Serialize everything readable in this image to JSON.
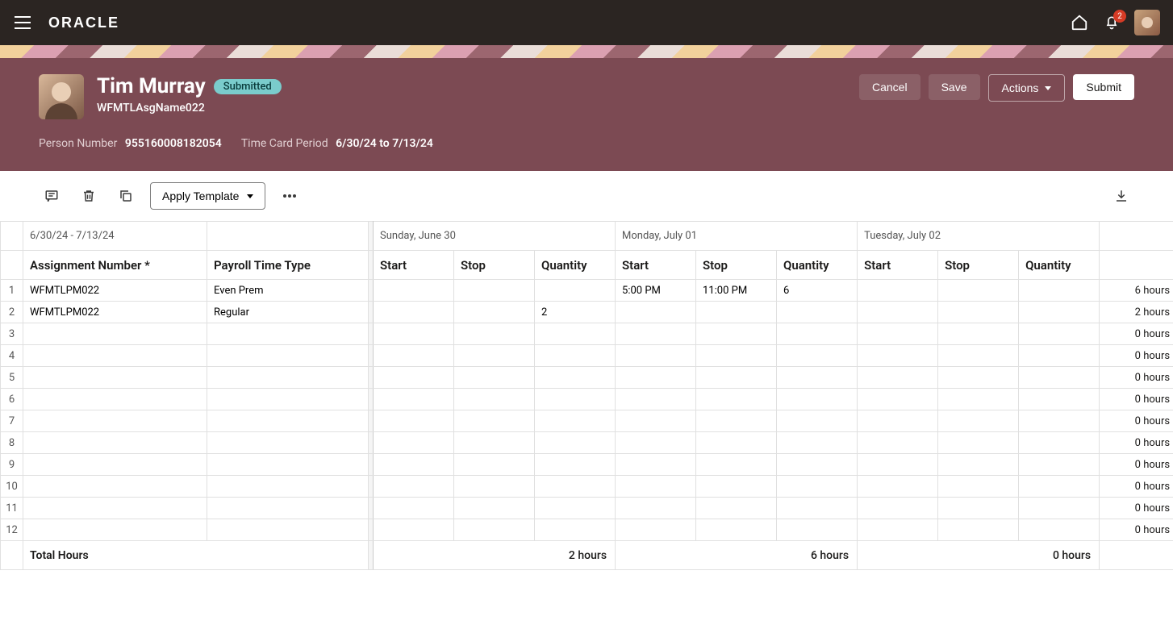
{
  "topbar": {
    "logo": "ORACLE",
    "notification_count": "2"
  },
  "header": {
    "person_name": "Tim Murray",
    "status": "Submitted",
    "assignment_name": "WFMTLAsgName022",
    "person_number_label": "Person Number",
    "person_number": "955160008182054",
    "period_label": "Time Card Period",
    "period": "6/30/24 to 7/13/24",
    "actions": {
      "cancel": "Cancel",
      "save": "Save",
      "actions": "Actions",
      "submit": "Submit"
    }
  },
  "toolbar": {
    "apply_template": "Apply Template"
  },
  "grid": {
    "date_range": "6/30/24 - 7/13/24",
    "days": [
      {
        "label": "Sunday, June 30",
        "total": "2 hours"
      },
      {
        "label": "Monday, July 01",
        "total": "6 hours"
      },
      {
        "label": "Tuesday, July 02",
        "total": "0 hours"
      }
    ],
    "col_headers": {
      "assignment": "Assignment Number *",
      "payroll_type": "Payroll Time Type",
      "start": "Start",
      "stop": "Stop",
      "quantity": "Quantity"
    },
    "rows": [
      {
        "n": "1",
        "asg": "WFMTLPM022",
        "ptt": "Even Prem",
        "d": [
          {
            "start": "",
            "stop": "",
            "qty": ""
          },
          {
            "start": "5:00 PM",
            "stop": "11:00 PM",
            "qty": "6"
          },
          {
            "start": "",
            "stop": "",
            "qty": ""
          }
        ],
        "tot": "6 hours"
      },
      {
        "n": "2",
        "asg": "WFMTLPM022",
        "ptt": "Regular",
        "d": [
          {
            "start": "",
            "stop": "",
            "qty": "2"
          },
          {
            "start": "",
            "stop": "",
            "qty": ""
          },
          {
            "start": "",
            "stop": "",
            "qty": ""
          }
        ],
        "tot": "2 hours"
      },
      {
        "n": "3",
        "asg": "",
        "ptt": "",
        "d": [
          {
            "start": "",
            "stop": "",
            "qty": ""
          },
          {
            "start": "",
            "stop": "",
            "qty": ""
          },
          {
            "start": "",
            "stop": "",
            "qty": ""
          }
        ],
        "tot": "0 hours"
      },
      {
        "n": "4",
        "asg": "",
        "ptt": "",
        "d": [
          {
            "start": "",
            "stop": "",
            "qty": ""
          },
          {
            "start": "",
            "stop": "",
            "qty": ""
          },
          {
            "start": "",
            "stop": "",
            "qty": ""
          }
        ],
        "tot": "0 hours"
      },
      {
        "n": "5",
        "asg": "",
        "ptt": "",
        "d": [
          {
            "start": "",
            "stop": "",
            "qty": ""
          },
          {
            "start": "",
            "stop": "",
            "qty": ""
          },
          {
            "start": "",
            "stop": "",
            "qty": ""
          }
        ],
        "tot": "0 hours"
      },
      {
        "n": "6",
        "asg": "",
        "ptt": "",
        "d": [
          {
            "start": "",
            "stop": "",
            "qty": ""
          },
          {
            "start": "",
            "stop": "",
            "qty": ""
          },
          {
            "start": "",
            "stop": "",
            "qty": ""
          }
        ],
        "tot": "0 hours"
      },
      {
        "n": "7",
        "asg": "",
        "ptt": "",
        "d": [
          {
            "start": "",
            "stop": "",
            "qty": ""
          },
          {
            "start": "",
            "stop": "",
            "qty": ""
          },
          {
            "start": "",
            "stop": "",
            "qty": ""
          }
        ],
        "tot": "0 hours"
      },
      {
        "n": "8",
        "asg": "",
        "ptt": "",
        "d": [
          {
            "start": "",
            "stop": "",
            "qty": ""
          },
          {
            "start": "",
            "stop": "",
            "qty": ""
          },
          {
            "start": "",
            "stop": "",
            "qty": ""
          }
        ],
        "tot": "0 hours"
      },
      {
        "n": "9",
        "asg": "",
        "ptt": "",
        "d": [
          {
            "start": "",
            "stop": "",
            "qty": ""
          },
          {
            "start": "",
            "stop": "",
            "qty": ""
          },
          {
            "start": "",
            "stop": "",
            "qty": ""
          }
        ],
        "tot": "0 hours"
      },
      {
        "n": "10",
        "asg": "",
        "ptt": "",
        "d": [
          {
            "start": "",
            "stop": "",
            "qty": ""
          },
          {
            "start": "",
            "stop": "",
            "qty": ""
          },
          {
            "start": "",
            "stop": "",
            "qty": ""
          }
        ],
        "tot": "0 hours"
      },
      {
        "n": "11",
        "asg": "",
        "ptt": "",
        "d": [
          {
            "start": "",
            "stop": "",
            "qty": ""
          },
          {
            "start": "",
            "stop": "",
            "qty": ""
          },
          {
            "start": "",
            "stop": "",
            "qty": ""
          }
        ],
        "tot": "0 hours"
      },
      {
        "n": "12",
        "asg": "",
        "ptt": "",
        "d": [
          {
            "start": "",
            "stop": "",
            "qty": ""
          },
          {
            "start": "",
            "stop": "",
            "qty": ""
          },
          {
            "start": "",
            "stop": "",
            "qty": ""
          }
        ],
        "tot": "0 hours"
      }
    ],
    "totals_label": "Total Hours"
  }
}
